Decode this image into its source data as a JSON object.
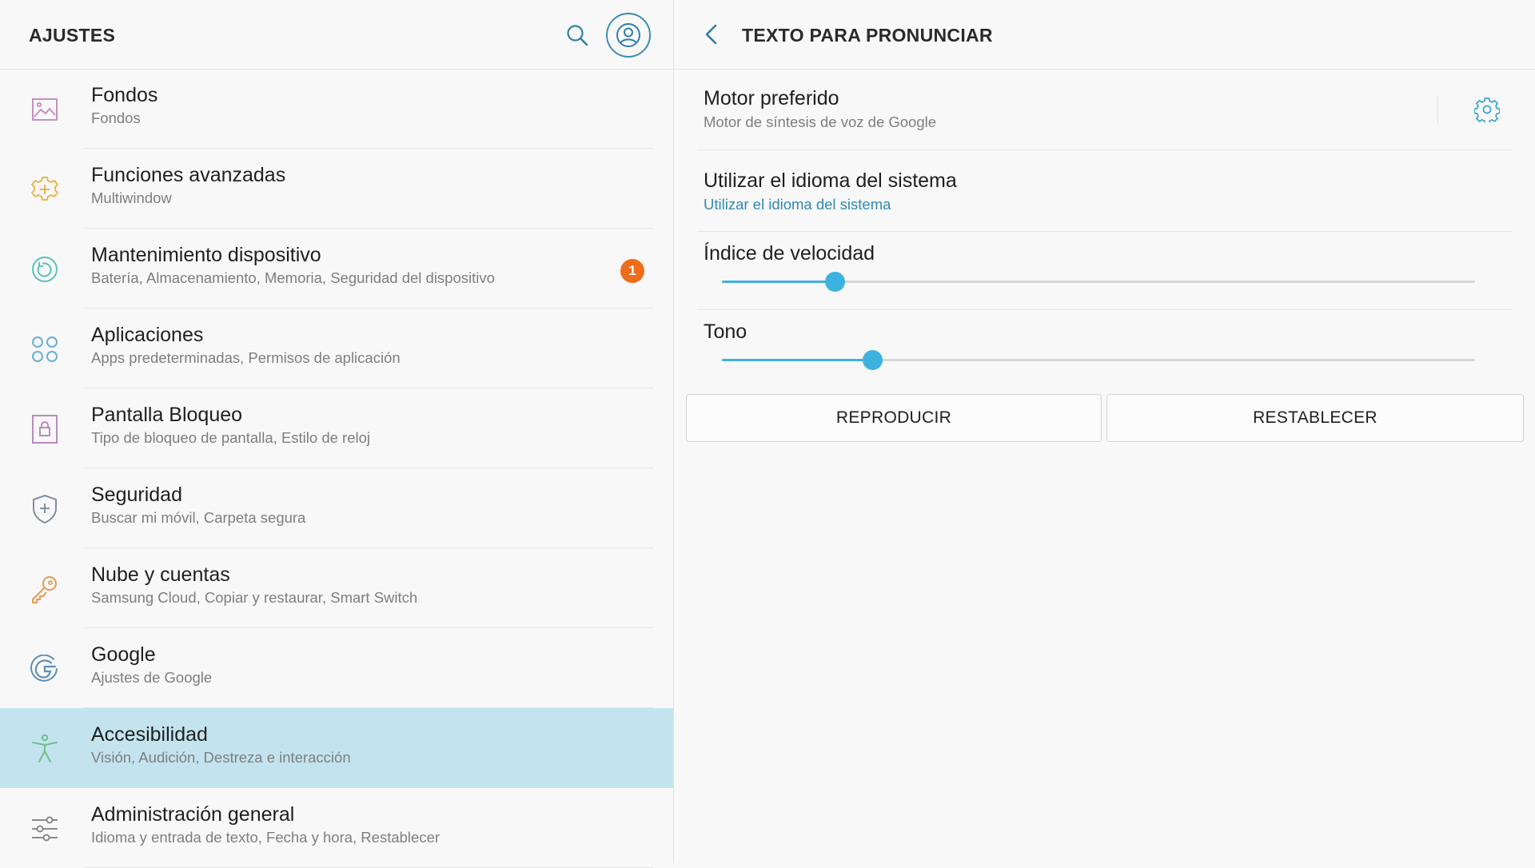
{
  "left_header": {
    "title": "AJUSTES",
    "search_icon": "search-icon",
    "account_icon": "account-icon"
  },
  "menu": [
    {
      "title": "Fondos",
      "subtitle": "Fondos",
      "icon": "image-icon",
      "icon_color": "#c68fc3"
    },
    {
      "title": "Funciones avanzadas",
      "subtitle": "Multiwindow",
      "icon": "gear-plus-icon",
      "icon_color": "#e8b64a"
    },
    {
      "title": "Mantenimiento dispositivo",
      "subtitle": "Batería, Almacenamiento, Memoria, Seguridad del dispositivo",
      "icon": "refresh-circle-icon",
      "icon_color": "#5cc2b9",
      "badge": "1"
    },
    {
      "title": "Aplicaciones",
      "subtitle": "Apps predeterminadas, Permisos de aplicación",
      "icon": "apps-grid-icon",
      "icon_color": "#6aaed6"
    },
    {
      "title": "Pantalla Bloqueo",
      "subtitle": "Tipo de bloqueo de pantalla, Estilo de reloj",
      "icon": "lock-icon",
      "icon_color": "#b98bbf"
    },
    {
      "title": "Seguridad",
      "subtitle": "Buscar mi móvil, Carpeta segura",
      "icon": "shield-icon",
      "icon_color": "#7f8fa1"
    },
    {
      "title": "Nube y cuentas",
      "subtitle": "Samsung Cloud, Copiar y restaurar, Smart Switch",
      "icon": "key-icon",
      "icon_color": "#e39b55"
    },
    {
      "title": "Google",
      "subtitle": "Ajustes de Google",
      "icon": "google-icon",
      "icon_color": "#5e8fb6"
    },
    {
      "title": "Accesibilidad",
      "subtitle": "Visión, Audición, Destreza e interacción",
      "icon": "accessibility-icon",
      "icon_color": "#6fbf8c",
      "selected": true
    },
    {
      "title": "Administración general",
      "subtitle": "Idioma y entrada de texto, Fecha y hora, Restablecer",
      "icon": "sliders-icon",
      "icon_color": "#8a8a8a"
    }
  ],
  "right_header": {
    "title": "TEXTO PARA PRONUNCIAR",
    "back_icon": "back-arrow-icon"
  },
  "preferred_engine": {
    "title": "Motor preferido",
    "subtitle": "Motor de síntesis de voz de Google",
    "settings_icon": "gear-icon"
  },
  "system_language": {
    "title": "Utilizar el idioma del sistema",
    "subtitle": "Utilizar el idioma del sistema"
  },
  "speech_rate": {
    "title": "Índice de velocidad",
    "value": 0.15
  },
  "pitch": {
    "title": "Tono",
    "value": 0.2
  },
  "buttons": {
    "play": "REPRODUCIR",
    "reset": "RESTABLECER"
  },
  "colors": {
    "accent": "#3eb2df",
    "selected_bg": "#c3e4ef",
    "badge": "#ef6c1a",
    "link": "#2f89b4"
  }
}
